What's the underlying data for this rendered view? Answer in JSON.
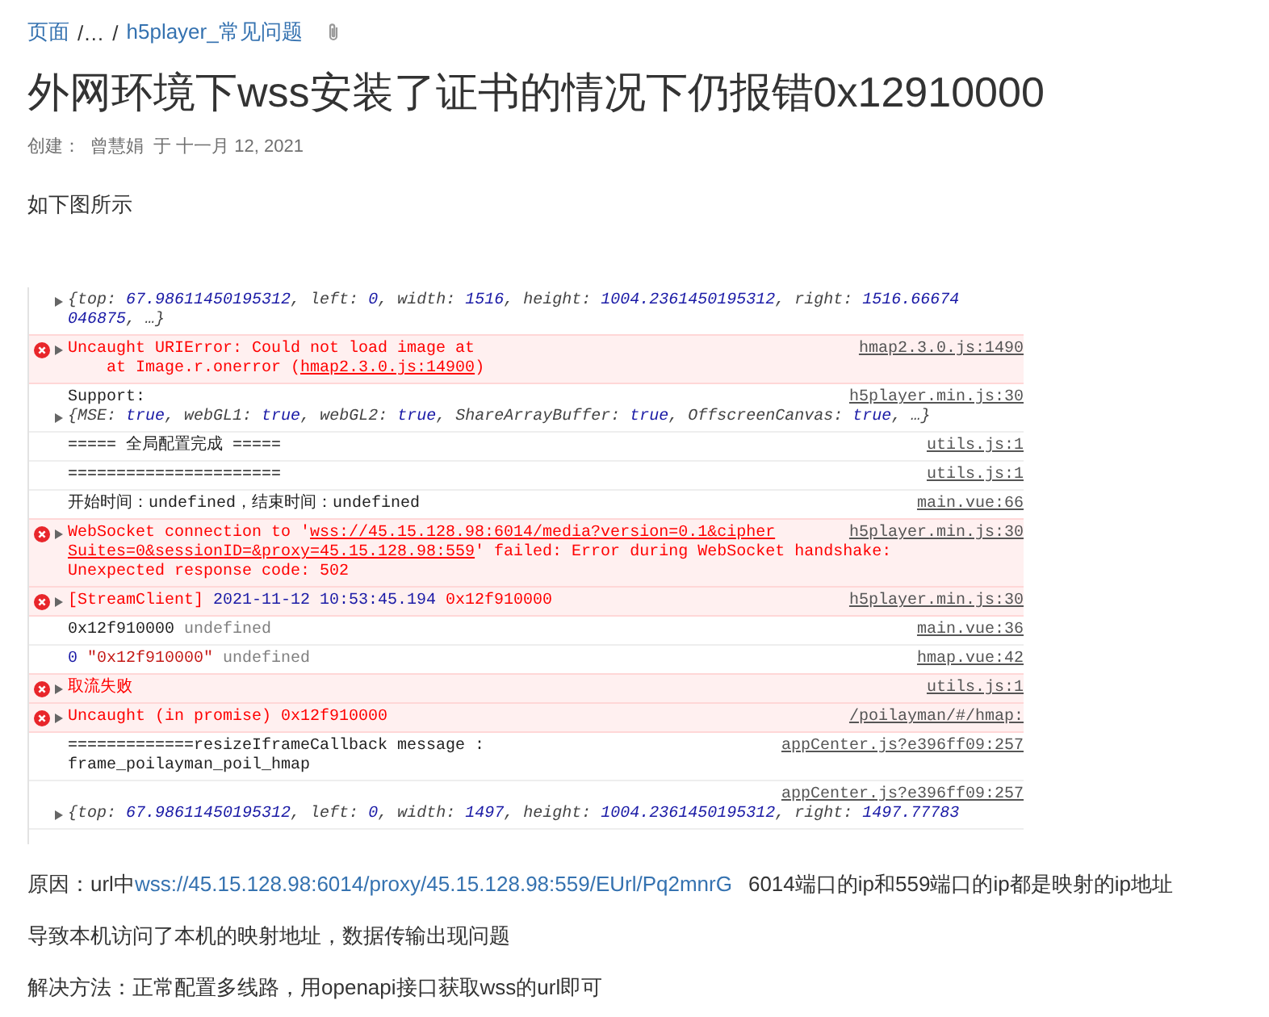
{
  "breadcrumb": {
    "items": [
      {
        "text": "页面",
        "kind": "link"
      },
      {
        "text": "/…",
        "kind": "plain"
      },
      {
        "text": "/",
        "kind": "plain"
      },
      {
        "text": "h5player_常见问题",
        "kind": "link"
      }
    ]
  },
  "title": "外网环境下wss安装了证书的情况下仍报错0x12910000",
  "meta": {
    "label": "创建：",
    "author": "曾慧娟",
    "date": "于 十一月 12, 2021"
  },
  "intro": "如下图所示",
  "console": {
    "entries": [
      {
        "kind": "info",
        "lines": [
          {
            "toggle": true,
            "segments": [
              {
                "kind": "obj",
                "text": "{top: "
              },
              {
                "kind": "val",
                "text": "67.98611450195312"
              },
              {
                "kind": "obj",
                "text": ", left: "
              },
              {
                "kind": "val",
                "text": "0"
              },
              {
                "kind": "obj",
                "text": ", width: "
              },
              {
                "kind": "val",
                "text": "1516"
              },
              {
                "kind": "obj",
                "text": ", height: "
              },
              {
                "kind": "val",
                "text": "1004.2361450195312"
              },
              {
                "kind": "obj",
                "text": ", right: "
              },
              {
                "kind": "val",
                "text": "1516.66674"
              }
            ]
          },
          {
            "toggle": false,
            "segments": [
              {
                "kind": "val",
                "text": "046875"
              },
              {
                "kind": "obj",
                "text": ", …}"
              }
            ]
          }
        ]
      },
      {
        "kind": "error",
        "source": "hmap2.3.0.js:1490",
        "lines": [
          {
            "toggle": true,
            "segments": [
              {
                "kind": "err",
                "text": "Uncaught URIError: Could not load image at"
              }
            ]
          },
          {
            "toggle": false,
            "segments": [
              {
                "kind": "err",
                "text": "    at Image.r.onerror ("
              },
              {
                "kind": "link",
                "text": "hmap2.3.0.js:14900"
              },
              {
                "kind": "err",
                "text": ")"
              }
            ]
          }
        ]
      },
      {
        "kind": "info",
        "source": "h5player.min.js:30",
        "lines": [
          {
            "toggle": false,
            "segments": [
              {
                "kind": "plain",
                "text": "Support:"
              }
            ]
          },
          {
            "toggle": true,
            "segments": [
              {
                "kind": "obj",
                "text": "{MSE: "
              },
              {
                "kind": "val",
                "text": "true"
              },
              {
                "kind": "obj",
                "text": ", webGL1: "
              },
              {
                "kind": "val",
                "text": "true"
              },
              {
                "kind": "obj",
                "text": ", webGL2: "
              },
              {
                "kind": "val",
                "text": "true"
              },
              {
                "kind": "obj",
                "text": ", ShareArrayBuffer: "
              },
              {
                "kind": "val",
                "text": "true"
              },
              {
                "kind": "obj",
                "text": ", OffscreenCanvas: "
              },
              {
                "kind": "val",
                "text": "true"
              },
              {
                "kind": "obj",
                "text": ", …}"
              }
            ]
          }
        ]
      },
      {
        "kind": "info",
        "source": "utils.js:1",
        "lines": [
          {
            "toggle": false,
            "segments": [
              {
                "kind": "plain",
                "text": "===== 全局配置完成 ====="
              }
            ]
          }
        ]
      },
      {
        "kind": "info",
        "source": "utils.js:1",
        "lines": [
          {
            "toggle": false,
            "segments": [
              {
                "kind": "plain",
                "text": "======================"
              }
            ]
          }
        ]
      },
      {
        "kind": "info",
        "source": "main.vue:66",
        "lines": [
          {
            "toggle": false,
            "segments": [
              {
                "kind": "plain",
                "text": "开始时间：undefined，结束时间：undefined"
              }
            ]
          }
        ]
      },
      {
        "kind": "error",
        "source": "h5player.min.js:30",
        "lines": [
          {
            "toggle": true,
            "segments": [
              {
                "kind": "err",
                "text": "WebSocket connection to '"
              },
              {
                "kind": "link",
                "text": "wss://45.15.128.98:6014/media?version=0.1&cipher"
              }
            ]
          },
          {
            "toggle": false,
            "segments": [
              {
                "kind": "link",
                "text": "Suites=0&sessionID=&proxy=45.15.128.98:559"
              },
              {
                "kind": "err",
                "text": "' failed: Error during WebSocket handshake:"
              }
            ]
          },
          {
            "toggle": false,
            "segments": [
              {
                "kind": "err",
                "text": "Unexpected response code: 502"
              }
            ]
          }
        ]
      },
      {
        "kind": "error",
        "source": "h5player.min.js:30",
        "lines": [
          {
            "toggle": true,
            "segments": [
              {
                "kind": "err",
                "text": "[StreamClient] "
              },
              {
                "kind": "blue",
                "text": "2021-11-12 10:53:45.194"
              },
              {
                "kind": "err",
                "text": " 0x12f910000"
              }
            ]
          }
        ]
      },
      {
        "kind": "info",
        "source": "main.vue:36",
        "lines": [
          {
            "toggle": false,
            "segments": [
              {
                "kind": "plain",
                "text": "0x12f910000 "
              },
              {
                "kind": "dim",
                "text": "undefined"
              }
            ]
          }
        ]
      },
      {
        "kind": "info",
        "source": "hmap.vue:42",
        "lines": [
          {
            "toggle": false,
            "segments": [
              {
                "kind": "blue",
                "text": "0"
              },
              {
                "kind": "str",
                "text": " \"0x12f910000\""
              },
              {
                "kind": "dim",
                "text": " undefined"
              }
            ]
          }
        ]
      },
      {
        "kind": "error",
        "source": "utils.js:1",
        "lines": [
          {
            "toggle": true,
            "segments": [
              {
                "kind": "err",
                "text": "取流失败"
              }
            ]
          }
        ]
      },
      {
        "kind": "error",
        "source": "/poilayman/#/hmap:",
        "lines": [
          {
            "toggle": true,
            "segments": [
              {
                "kind": "err",
                "text": "Uncaught (in promise) 0x12f910000"
              }
            ]
          }
        ]
      },
      {
        "kind": "info",
        "source": "appCenter.js?e396ff09:257",
        "lines": [
          {
            "toggle": false,
            "segments": [
              {
                "kind": "plain",
                "text": "=============resizeIframeCallback message :"
              }
            ]
          },
          {
            "toggle": false,
            "segments": [
              {
                "kind": "plain",
                "text": "frame_poilayman_poil_hmap"
              }
            ]
          }
        ]
      },
      {
        "kind": "info",
        "source": "appCenter.js?e396ff09:257",
        "source_own_line": true,
        "lines": [
          {
            "toggle": true,
            "segments": [
              {
                "kind": "obj",
                "text": "{top: "
              },
              {
                "kind": "val",
                "text": "67.98611450195312"
              },
              {
                "kind": "obj",
                "text": ", left: "
              },
              {
                "kind": "val",
                "text": "0"
              },
              {
                "kind": "obj",
                "text": ", width: "
              },
              {
                "kind": "val",
                "text": "1497"
              },
              {
                "kind": "obj",
                "text": ", height: "
              },
              {
                "kind": "val",
                "text": "1004.2361450195312"
              },
              {
                "kind": "obj",
                "text": ", right: "
              },
              {
                "kind": "val",
                "text": "1497.77783"
              }
            ]
          }
        ]
      }
    ]
  },
  "reason": {
    "prefix": "原因：url中",
    "link": "wss://45.15.128.98:6014/proxy/45.15.128.98:559/EUrl/Pq2mnrG",
    "suffix": "6014端口的ip和559端口的ip都是映射的ip地址"
  },
  "paragraphs": [
    "导致本机访问了本机的映射地址，数据传输出现问题",
    "解决方法：正常配置多线路，用openapi接口获取wss的url即可"
  ]
}
